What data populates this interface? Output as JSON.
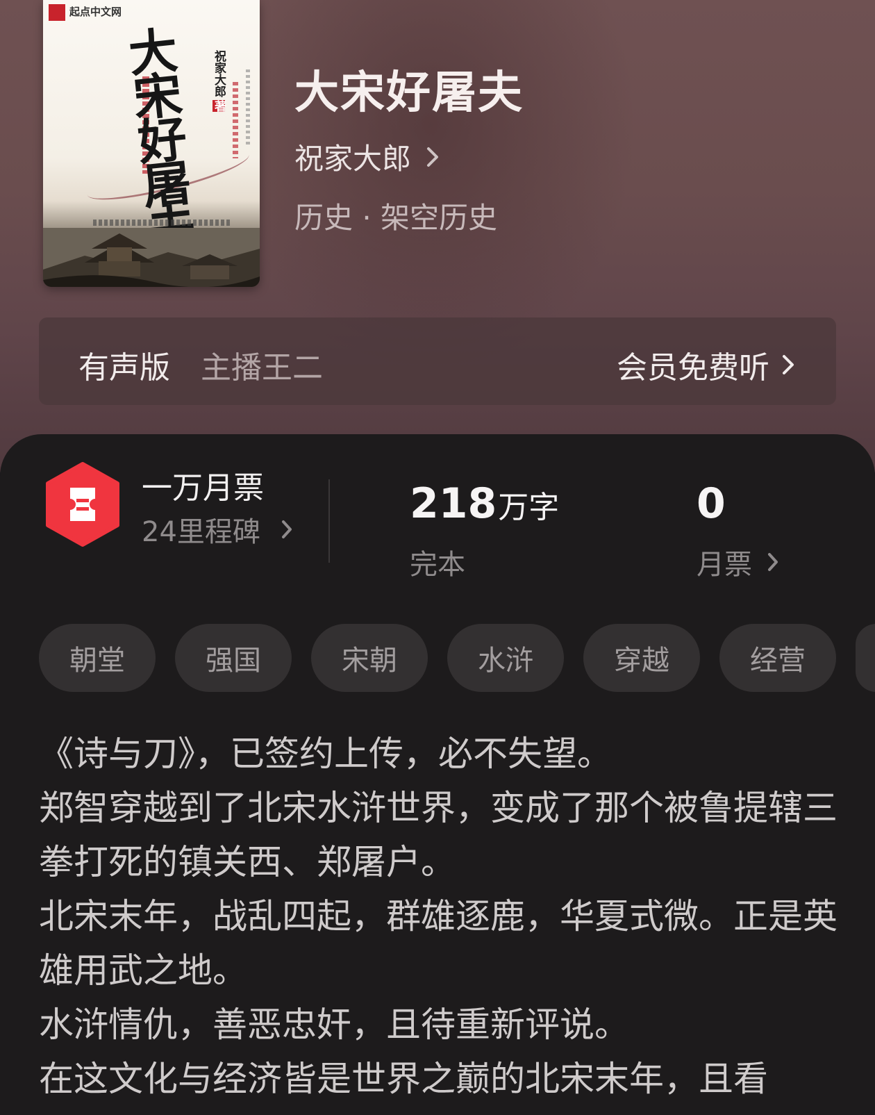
{
  "book": {
    "title": "大宋好屠夫",
    "author": "祝家大郎",
    "genre": "历史 · 架空历史",
    "cover": {
      "brand": "起点中文网",
      "title_text": "大宋好屠夫",
      "author_text": "祝家大郎",
      "zhu_mark": "著"
    }
  },
  "audio": {
    "label": "有声版",
    "host": "主播王二",
    "action": "会员免费听"
  },
  "stats": {
    "milestone_title": "一万月票",
    "milestone_sub": "24里程碑",
    "word_count": "218",
    "word_unit": "万字",
    "status": "完本",
    "monthly_tickets": "0",
    "monthly_label": "月票"
  },
  "tags": [
    "朝堂",
    "强国",
    "宋朝",
    "水浒",
    "穿越",
    "经营"
  ],
  "synopsis": [
    "《诗与刀》，已签约上传，必不失望。",
    "郑智穿越到了北宋水浒世界，变成了那个被鲁提辖三拳打死的镇关西、郑屠户。",
    "北宋末年，战乱四起，群雄逐鹿，华夏式微。正是英雄用武之地。",
    "水浒情仇，善恶忠奸，且待重新评说。",
    "在这文化与经济皆是世界之巅的北宋末年，且看"
  ],
  "colors": {
    "hero_bg": "#6a4d4e",
    "card_bg": "#1d1b1c",
    "tag_bg": "#333031",
    "ticket_red": "#f0353f"
  }
}
